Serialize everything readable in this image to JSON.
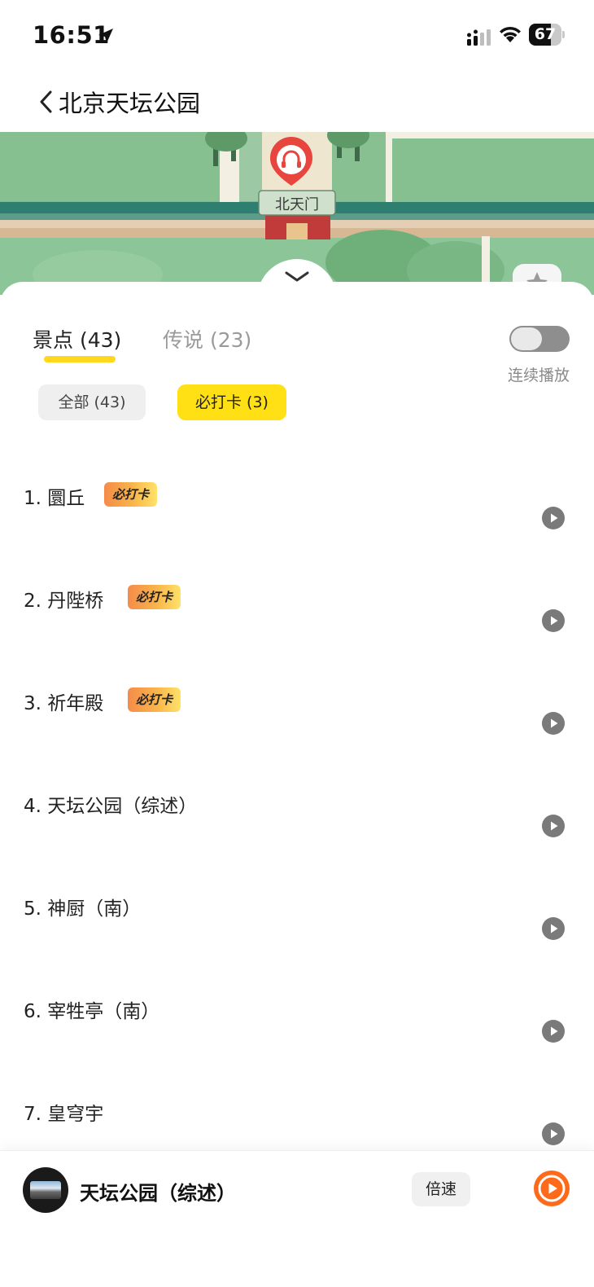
{
  "status_bar": {
    "time": "16:51",
    "battery": "67",
    "battery_level": 0.67
  },
  "nav": {
    "title": "北京天坛公园"
  },
  "map": {
    "marker_label": "北天门"
  },
  "tabs": [
    {
      "label": "景点 (43)",
      "active": true
    },
    {
      "label": "传说 (23)",
      "active": false
    }
  ],
  "toggle": {
    "label": "连续播放",
    "on": false
  },
  "filters": [
    {
      "label": "全部 (43)",
      "selected": false
    },
    {
      "label": "必打卡 (3)",
      "selected": true
    }
  ],
  "items": [
    {
      "title": "1. 圜丘",
      "badge": "必打卡"
    },
    {
      "title": "2. 丹陛桥",
      "badge": "必打卡"
    },
    {
      "title": "3. 祈年殿",
      "badge": "必打卡"
    },
    {
      "title": "4. 天坛公园（综述）"
    },
    {
      "title": "5. 神厨（南）"
    },
    {
      "title": "6. 宰牲亭（南）"
    },
    {
      "title": "7. 皇穹宇"
    }
  ],
  "player": {
    "title": "天坛公园（综述）",
    "speed_label": "倍速"
  },
  "colors": {
    "accent_yellow": "#ffe014",
    "underline_yellow": "#ffd81e",
    "play_orange": "#ff6a1a",
    "map_green": "#7fb98a"
  }
}
